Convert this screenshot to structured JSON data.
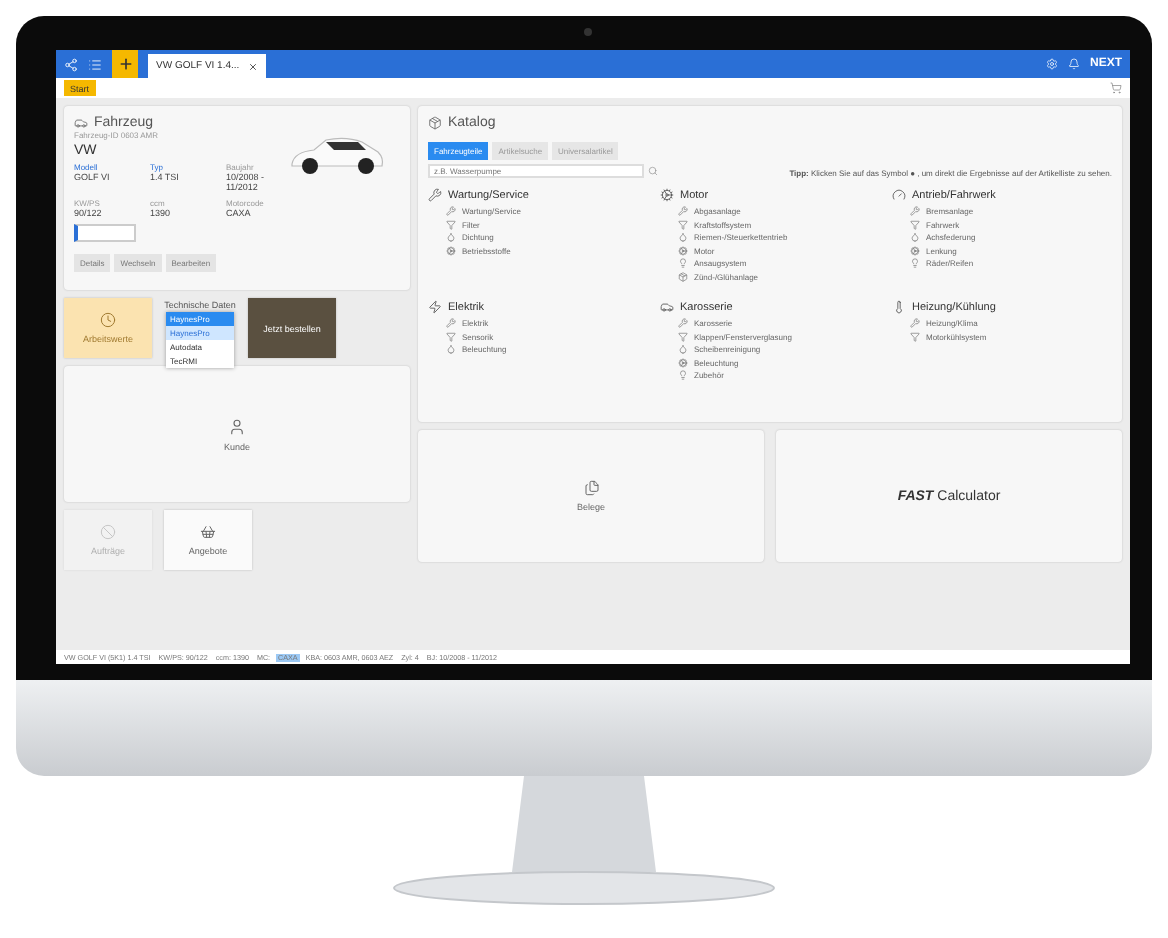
{
  "topbar": {
    "tab": "VW GOLF VI 1.4...",
    "logo": "NEXT"
  },
  "start_button": "Start",
  "vehicle": {
    "title": "Fahrzeug",
    "subtitle": "Fahrzeug-ID 0603 AMR",
    "make": "VW",
    "fields": [
      {
        "label": "Modell",
        "value": "GOLF VI"
      },
      {
        "label": "Typ",
        "value": "1.4 TSI"
      },
      {
        "label": "Baujahr",
        "value": "10/2008 - 11/2012"
      },
      {
        "label": "KW/PS",
        "value": "90/122"
      },
      {
        "label": "ccm",
        "value": "1390"
      },
      {
        "label": "Motorcode",
        "value": "CAXA"
      }
    ],
    "buttons": [
      "Details",
      "Wechseln",
      "Bearbeiten"
    ]
  },
  "tiles": {
    "work": "Arbeitswerte",
    "tech": "Technische Daten",
    "tech_selected": "HaynesPro",
    "options": [
      {
        "label": "HaynesPro",
        "selected": true
      },
      {
        "label": "Autodata",
        "selected": false
      },
      {
        "label": "TecRMI",
        "selected": false
      }
    ],
    "order": "Jetzt bestellen"
  },
  "customer": "Kunde",
  "small_tiles": [
    {
      "label": "Aufträge",
      "disabled": true
    },
    {
      "label": "Angebote",
      "disabled": false
    }
  ],
  "catalog": {
    "title": "Katalog",
    "tabs": [
      {
        "label": "Fahrzeugteile",
        "selected": true
      },
      {
        "label": "Artikelsuche",
        "selected": false
      },
      {
        "label": "Universalartikel",
        "selected": false
      }
    ],
    "search_placeholder": "z.B. Wasserpumpe",
    "tip": "**Tipp:** Klicken Sie auf das Symbol ● , um direkt die Ergebnisse auf der Artikelliste zu sehen.",
    "groups": [
      {
        "title": "Wartung/Service",
        "items": [
          "Wartung/Service",
          "Filter",
          "Dichtung",
          "Betriebsstoffe"
        ]
      },
      {
        "title": "Motor",
        "items": [
          "Abgasanlage",
          "Kraftstoffsystem",
          "Riemen-/Steuerkettentrieb",
          "Motor",
          "Ansaugsystem",
          "Zünd-/Glühanlage"
        ]
      },
      {
        "title": "Antrieb/Fahrwerk",
        "items": [
          "Bremsanlage",
          "Fahrwerk",
          "Achsfederung",
          "Lenkung",
          "Räder/Reifen"
        ]
      },
      {
        "title": "Elektrik",
        "items": [
          "Elektrik",
          "Sensorik",
          "Beleuchtung"
        ]
      },
      {
        "title": "Karosserie",
        "items": [
          "Karosserie",
          "Klappen/Fensterverglasung",
          "Scheibenreinigung",
          "Beleuchtung",
          "Zubehör"
        ]
      },
      {
        "title": "Heizung/Kühlung",
        "items": [
          "Heizung/Klima",
          "Motorkühlsystem"
        ]
      }
    ]
  },
  "cards": {
    "documents": "Belege",
    "calculator": "**FAST** Calculator"
  },
  "status_bar": [
    {
      "text": "VW GOLF VI (5K1) 1.4 TSI",
      "highlighted": false
    },
    {
      "text": "KW/PS: 90/122",
      "highlighted": false
    },
    {
      "text": "ccm: 1390",
      "highlighted": false
    },
    {
      "text": "MC:",
      "highlighted": false
    },
    {
      "text": "CAXA",
      "highlighted": true
    },
    {
      "text": "KBA: 0603 AMR, 0603 AEZ",
      "highlighted": false
    },
    {
      "text": "Zyl: 4",
      "highlighted": false
    },
    {
      "text": "BJ: 10/2008 - 11/2012",
      "highlighted": false
    }
  ]
}
